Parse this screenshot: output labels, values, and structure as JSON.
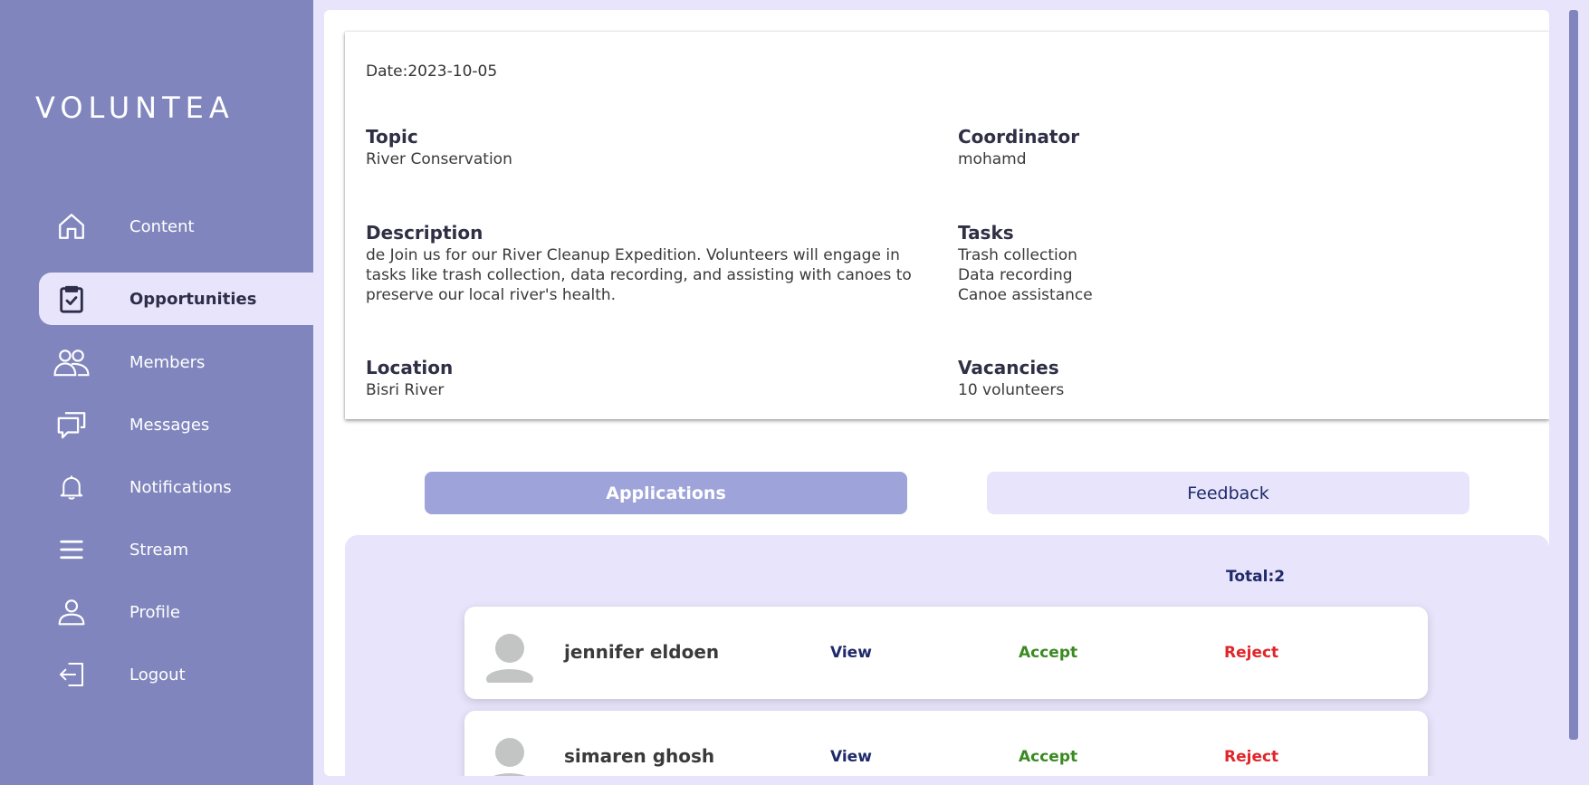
{
  "app": {
    "logo": "VOLUNTEA"
  },
  "sidebar": {
    "items": [
      {
        "label": "Content",
        "icon": "home-icon"
      },
      {
        "label": "Opportunities",
        "icon": "clipboard-check-icon",
        "active": true
      },
      {
        "label": "Members",
        "icon": "users-icon"
      },
      {
        "label": "Messages",
        "icon": "chat-icon"
      },
      {
        "label": "Notifications",
        "icon": "bell-icon"
      },
      {
        "label": "Stream",
        "icon": "menu-icon"
      },
      {
        "label": "Profile",
        "icon": "user-icon"
      },
      {
        "label": "Logout",
        "icon": "logout-icon"
      }
    ]
  },
  "opportunity": {
    "date": "Date:2023-10-05",
    "topic": {
      "title": "Topic",
      "value": "River Conservation"
    },
    "coordinator": {
      "title": "Coordinator",
      "value": "mohamd"
    },
    "description": {
      "title": "Description",
      "value": "de Join us for our River Cleanup Expedition. Volunteers will engage in tasks like trash collection, data recording, and assisting with canoes to preserve our local river's health."
    },
    "tasks": {
      "title": "Tasks",
      "items": [
        "Trash collection",
        "Data recording",
        "Canoe assistance"
      ]
    },
    "location": {
      "title": "Location",
      "value": "Bisri River"
    },
    "vacancies": {
      "title": "Vacancies",
      "value": "10 volunteers"
    }
  },
  "tabs": {
    "applications": "Applications",
    "feedback": "Feedback"
  },
  "applications": {
    "total": "Total:2",
    "rows": [
      {
        "name": "jennifer eldoen",
        "view": "View",
        "accept": "Accept",
        "reject": "Reject"
      },
      {
        "name": "simaren ghosh",
        "view": "View",
        "accept": "Accept",
        "reject": "Reject"
      }
    ]
  },
  "colors": {
    "sidebar": "#8086bd",
    "background": "#e8e4fb",
    "active_tab": "#9ea3d9",
    "accept": "#3a8a22",
    "reject": "#e0262a",
    "link": "#1e2a6a"
  }
}
